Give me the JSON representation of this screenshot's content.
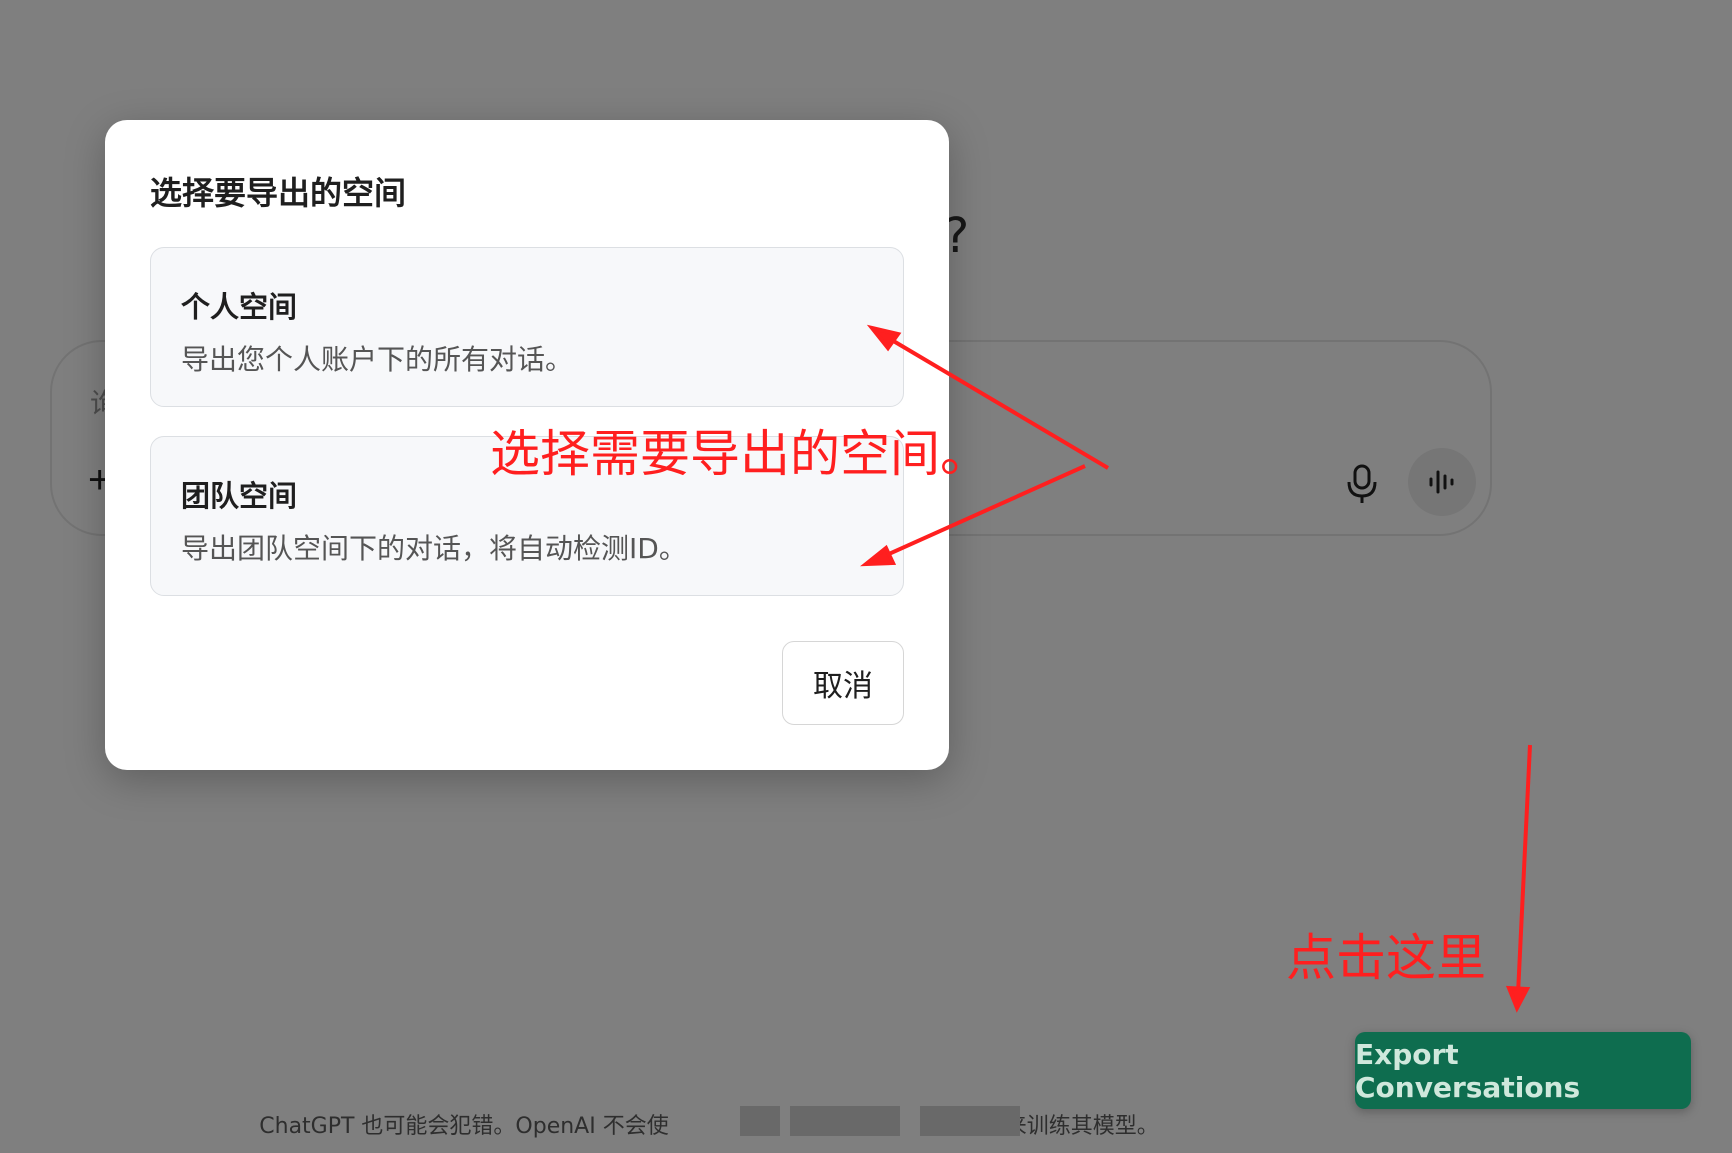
{
  "background": {
    "heading_fragment": "]?",
    "composer_placeholder_fragment": "询",
    "plus_glyph": "+",
    "footer_note_left": "ChatGPT 也可能会犯错。OpenAI 不会使",
    "footer_note_right": "的数据来训练其模型。"
  },
  "modal": {
    "title": "选择要导出的空间",
    "options": [
      {
        "title": "个人空间",
        "description": "导出您个人账户下的所有对话。"
      },
      {
        "title": "团队空间",
        "description": "导出团队空间下的对话，将自动检测ID。"
      }
    ],
    "cancel_label": "取消"
  },
  "export_button_label": "Export Conversations",
  "annotations": {
    "select_space": "选择需要导出的空间。",
    "click_here": "点击这里"
  },
  "colors": {
    "overlay": "rgba(0,0,0,0.5)",
    "annotation": "#ff1f1f",
    "export_button": "#0e6d4f"
  },
  "icons": [
    "microphone-icon",
    "voice-mode-icon",
    "plus-icon",
    "arrow-icon"
  ]
}
